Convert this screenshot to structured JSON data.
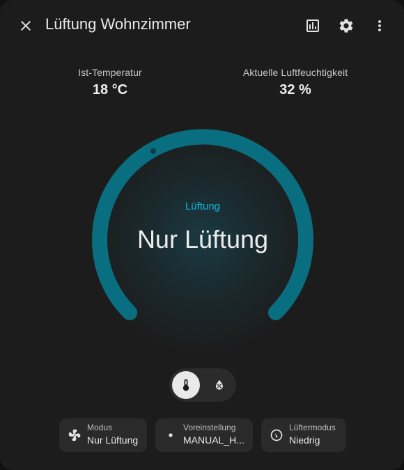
{
  "window": {
    "title": "Lüftung Wohnzimmer"
  },
  "header": {
    "close_icon": "close-icon",
    "history_icon": "chart-bar-icon",
    "settings_icon": "gear-icon",
    "more_icon": "dots-vertical-icon"
  },
  "attributes": [
    {
      "label": "Ist-Temperatur",
      "value": "18 °C"
    },
    {
      "label": "Aktuelle Luftfeuchtigkeit",
      "value": "32 %"
    }
  ],
  "dial": {
    "label": "Lüftung",
    "state": "Nur Lüftung",
    "accent_color": "#0a6e81",
    "label_color": "#12b5dc"
  },
  "view_toggle": {
    "options": [
      {
        "icon": "thermometer-icon",
        "selected": true
      },
      {
        "icon": "water-percent-icon",
        "selected": false
      }
    ]
  },
  "chips": [
    {
      "icon": "fan-icon",
      "title": "Modus",
      "value": "Nur Lüftung"
    },
    {
      "icon": "dot-icon",
      "title": "Voreinstellung",
      "value": "MANUAL_H..."
    },
    {
      "icon": "fan-speed-icon",
      "title": "Lüftermodus",
      "value": "Niedrig"
    }
  ]
}
